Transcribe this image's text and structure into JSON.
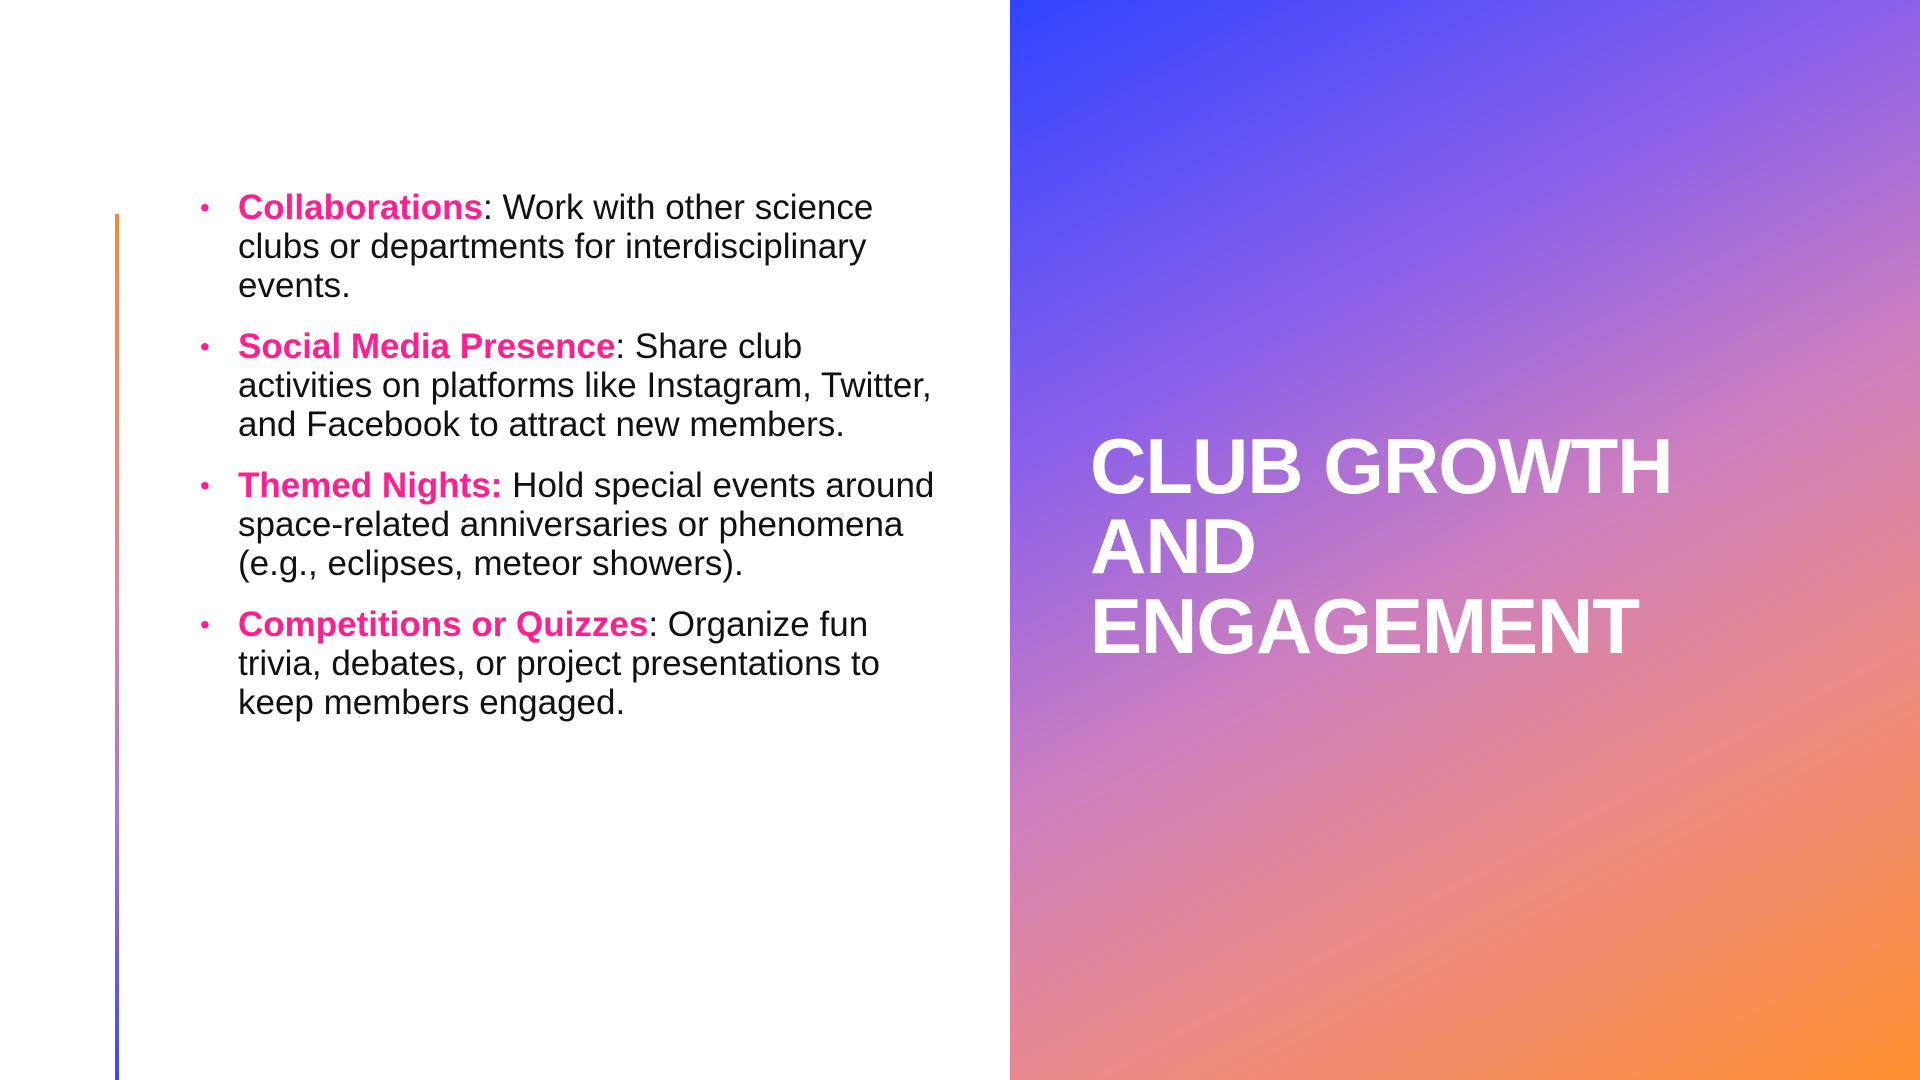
{
  "slide": {
    "title_lines": [
      "CLUB GROWTH",
      "AND",
      "ENGAGEMENT"
    ],
    "bullets": [
      {
        "term": "Collaborations",
        "text": ": Work with other science clubs or departments for interdisciplinary events."
      },
      {
        "term": "Social Media Presence",
        "text": ": Share club activities on platforms like Instagram, Twitter, and Facebook to attract new members."
      },
      {
        "term": "Themed Nights:",
        "text": " Hold special events around space-related anniversaries or phenomena (e.g., eclipses, meteor showers)."
      },
      {
        "term": "Competitions or Quizzes",
        "text": ": Organize fun trivia, debates, or project presentations to keep members engaged."
      }
    ]
  },
  "colors": {
    "accent_pink": "#ff1f8e",
    "gradient_start": "#3044ff",
    "gradient_end": "#ff9030"
  }
}
